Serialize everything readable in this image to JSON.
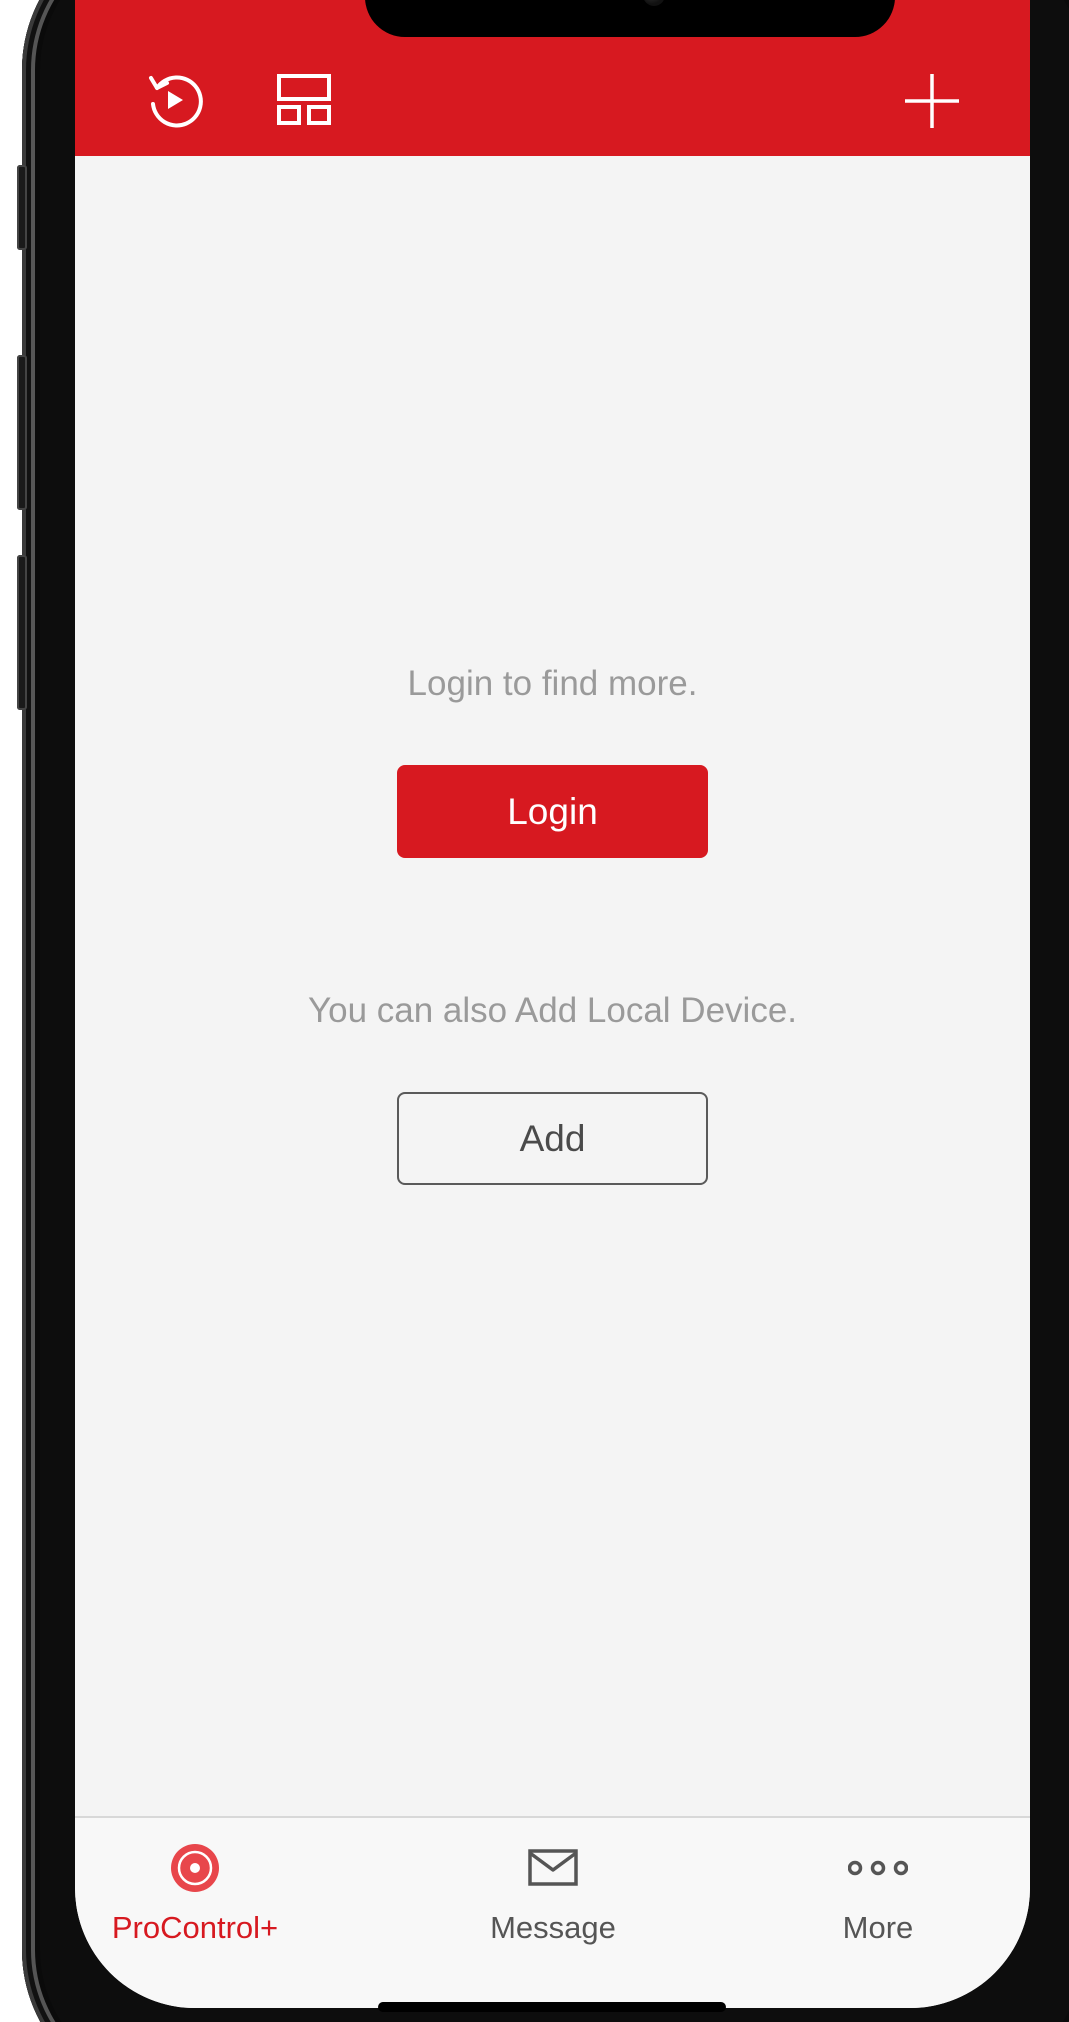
{
  "header": {
    "background_color": "#d71920",
    "playback_icon": "playback-icon",
    "layout_icon": "layout-icon",
    "add_icon": "plus-icon"
  },
  "main": {
    "login_prompt": "Login to find more.",
    "login_button": "Login",
    "local_prompt": "You can also Add Local Device.",
    "add_button": "Add"
  },
  "tabbar": {
    "tabs": [
      {
        "label": "ProControl+",
        "icon": "procontrol-icon",
        "active": true,
        "color": "#d71920"
      },
      {
        "label": "Message",
        "icon": "envelope-icon",
        "active": false,
        "color": "#555555"
      },
      {
        "label": "More",
        "icon": "more-dots-icon",
        "active": false,
        "color": "#555555"
      }
    ]
  }
}
